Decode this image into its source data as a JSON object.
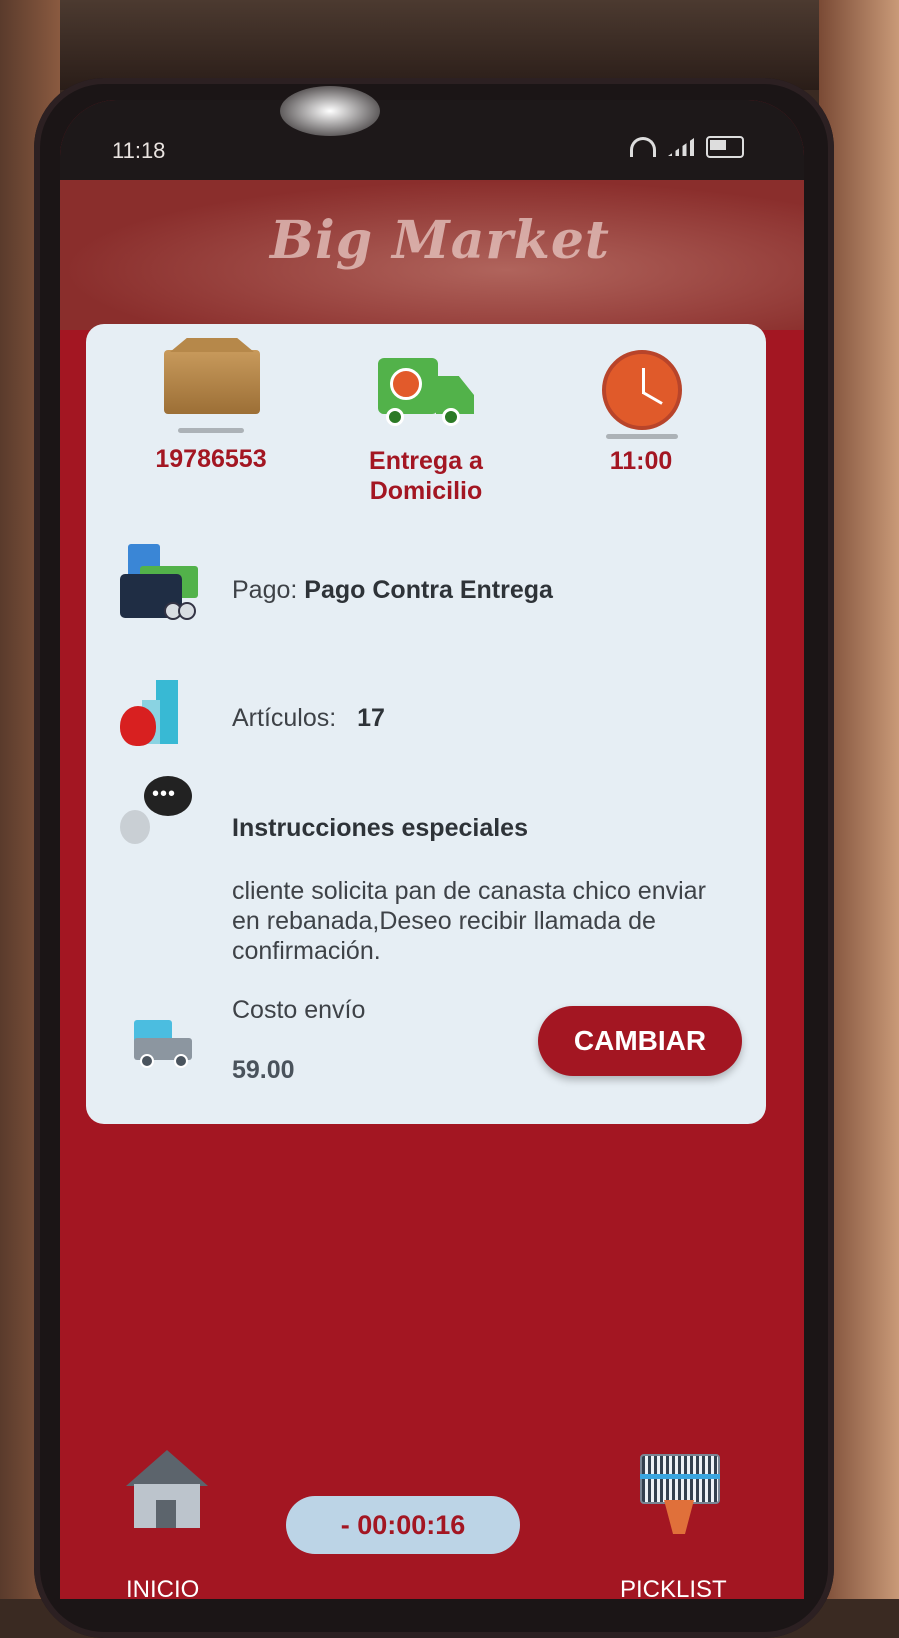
{
  "status_bar": {
    "time": "11:18"
  },
  "header": {
    "logo_text": "Big Market"
  },
  "order": {
    "id": "19786553",
    "delivery_type": "Entrega a Domicilio",
    "time": "11:00"
  },
  "payment": {
    "label": "Pago:",
    "value": "Pago Contra Entrega"
  },
  "items": {
    "label": "Artículos:",
    "count": "17"
  },
  "instructions": {
    "title": "Instrucciones especiales",
    "text": "cliente solicita pan de canasta chico enviar en rebanada,Deseo recibir llamada de confirmación."
  },
  "shipping": {
    "label": "Costo envío",
    "value": "59.00",
    "button_label": "CAMBIAR"
  },
  "bottom_nav": {
    "home_label": "INICIO",
    "timer": "- 00:00:16",
    "picklist_label": "PICKLIST"
  },
  "colors": {
    "brand_red": "#a31622",
    "card_bg": "#e6eef4"
  }
}
